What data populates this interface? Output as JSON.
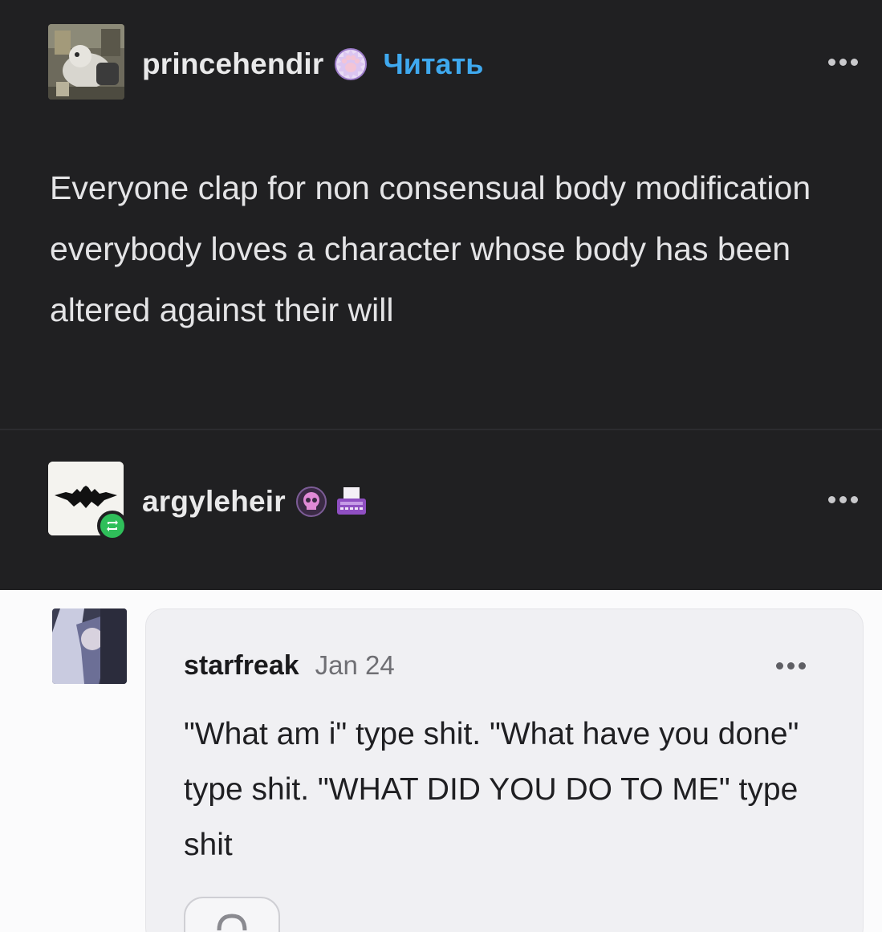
{
  "post": {
    "author": {
      "username": "princehendir",
      "follow_label": "Читать",
      "badge_icon": "paw-badge-icon"
    },
    "body": "Everyone clap for non consensual body modification everybody loves a character whose body has been altered against their will"
  },
  "reblog": {
    "username": "argyleheir",
    "badges": [
      "skull-badge-icon",
      "typewriter-badge-icon"
    ],
    "reblog_icon": "reblog-icon"
  },
  "reply": {
    "username": "starfreak",
    "date": "Jan 24",
    "body": "\"What am i\" type shit. \"What have you done\" type shit. \"WHAT DID YOU DO TO ME\" type shit"
  },
  "colors": {
    "dark_bg": "#202022",
    "light_bg": "#fbfbfc",
    "follow_accent": "#3fa9ef",
    "reblog_green": "#2fbf5a"
  }
}
